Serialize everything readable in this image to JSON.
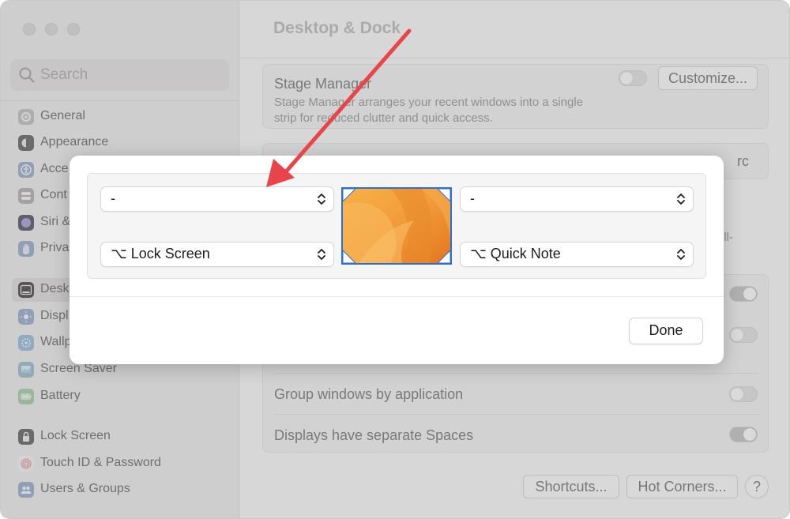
{
  "window": {
    "title": "Desktop & Dock"
  },
  "search": {
    "placeholder": "Search"
  },
  "sidebar": {
    "items": [
      {
        "label": "General",
        "icon": "gear-icon"
      },
      {
        "label": "Appearance",
        "icon": "appearance-icon"
      },
      {
        "label": "Acce",
        "icon": "accessibility-icon"
      },
      {
        "label": "Cont",
        "icon": "control-center-icon"
      },
      {
        "label": "Siri &",
        "icon": "siri-icon"
      },
      {
        "label": "Priva",
        "icon": "privacy-hand-icon"
      },
      {
        "label": "Desk",
        "icon": "desktop-dock-icon"
      },
      {
        "label": "Displ",
        "icon": "display-icon"
      },
      {
        "label": "Wallp",
        "icon": "wallpaper-icon"
      },
      {
        "label": "Screen Saver",
        "icon": "screen-saver-icon"
      },
      {
        "label": "Battery",
        "icon": "battery-icon"
      },
      {
        "label": "Lock Screen",
        "icon": "lock-icon"
      },
      {
        "label": "Touch ID & Password",
        "icon": "fingerprint-icon"
      },
      {
        "label": "Users & Groups",
        "icon": "users-icon"
      }
    ]
  },
  "main": {
    "stage_manager": {
      "title": "Stage Manager",
      "description": "Stage Manager arranges your recent windows into a single strip for reduced clutter and quick access.",
      "customize_label": "Customize..."
    },
    "partial_select_text": "rc",
    "partial_text": "ull-",
    "rows": [
      {
        "label": "Group windows by application",
        "on": false
      },
      {
        "label": "Displays have separate Spaces",
        "on": true
      }
    ],
    "buttons": {
      "shortcuts": "Shortcuts...",
      "hot_corners": "Hot Corners...",
      "help": "?"
    }
  },
  "modal": {
    "top_left": "-",
    "top_right": "-",
    "bottom_left": "⌥ Lock Screen",
    "bottom_right": "⌥ Quick Note",
    "done_label": "Done"
  },
  "colors": {
    "annotation_arrow": "#e8454a",
    "preview_border": "#2f6fcf",
    "wallpaper": "#f29b3a"
  }
}
